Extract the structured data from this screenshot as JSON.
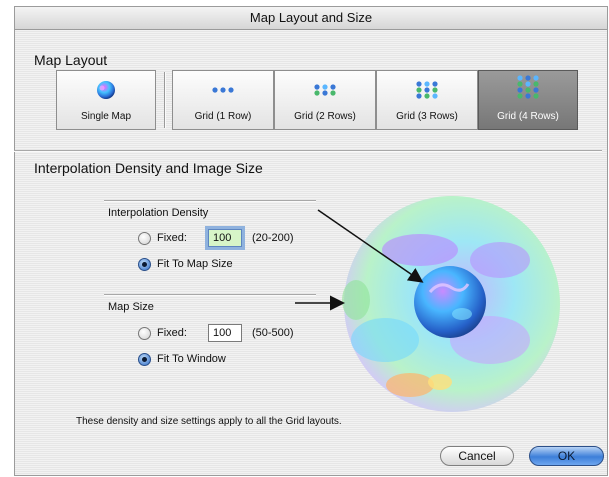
{
  "window": {
    "title": "Map Layout and Size"
  },
  "map_layout": {
    "section_title": "Map Layout",
    "buttons": [
      {
        "label": "Single Map",
        "selected": false
      },
      {
        "label": "Grid (1 Row)",
        "selected": false
      },
      {
        "label": "Grid (2 Rows)",
        "selected": false
      },
      {
        "label": "Grid (3 Rows)",
        "selected": false
      },
      {
        "label": "Grid (4 Rows)",
        "selected": true
      }
    ]
  },
  "interpolation_image_size": {
    "section_title": "Interpolation Density and Image Size",
    "interpolation_density": {
      "title": "Interpolation Density",
      "fixed_label": "Fixed:",
      "fixed_value": "100",
      "range_label": "(20-200)",
      "fit_label": "Fit To Map Size",
      "selected": "fit"
    },
    "map_size": {
      "title": "Map Size",
      "fixed_label": "Fixed:",
      "fixed_value": "100",
      "range_label": "(50-500)",
      "fit_label": "Fit To Window",
      "selected": "fit"
    },
    "footer_note": "These density and size settings apply to all the Grid layouts."
  },
  "actions": {
    "cancel_label": "Cancel",
    "ok_label": "OK"
  },
  "colors": {
    "accent": "#3d7fd9",
    "selected_button": "#8a8a8a",
    "field_focus": "#d7f5c8"
  }
}
